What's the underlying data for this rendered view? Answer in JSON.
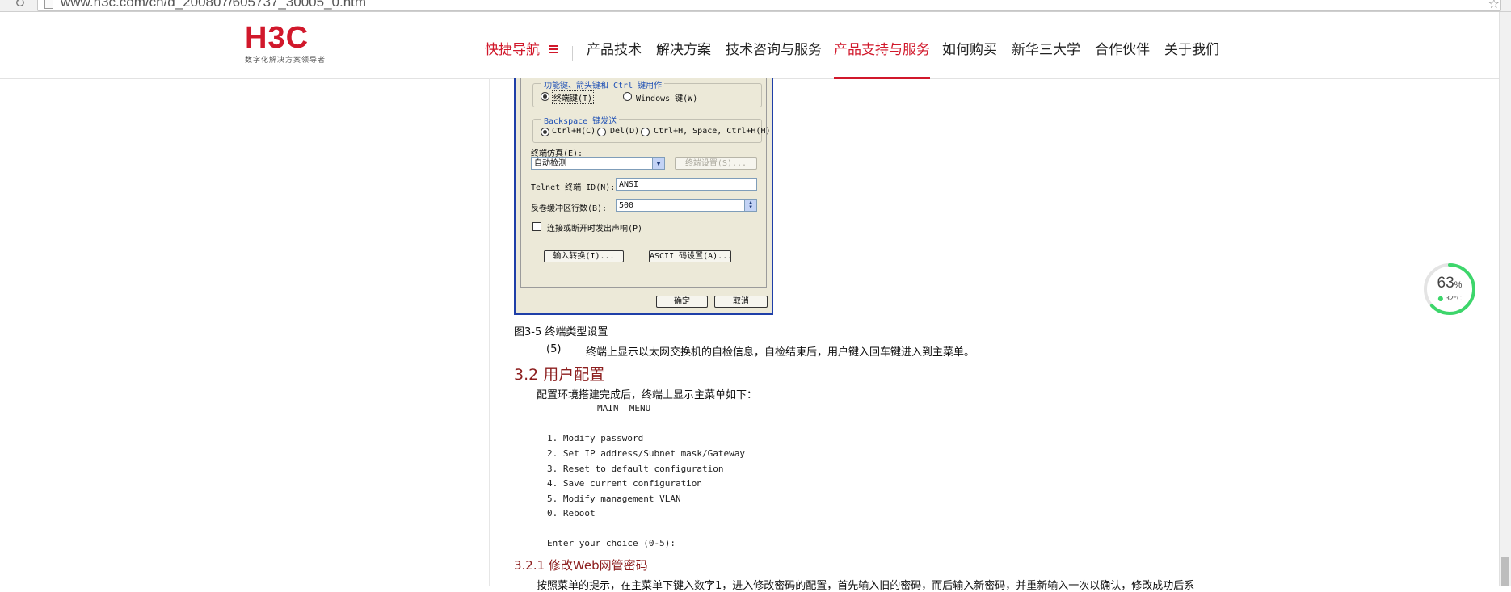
{
  "browser": {
    "url": "www.h3c.com/cn/d_200807/605737_30005_0.htm"
  },
  "site": {
    "logo": "H3C",
    "tagline": "数字化解决方案领导者",
    "nav": [
      {
        "label": "快捷导航"
      },
      {
        "label": "产品技术"
      },
      {
        "label": "解决方案"
      },
      {
        "label": "技术咨询与服务"
      },
      {
        "label": "产品支持与服务"
      },
      {
        "label": "如何购买"
      },
      {
        "label": "新华三大学"
      },
      {
        "label": "合作伙伴"
      },
      {
        "label": "关于我们"
      }
    ],
    "active_nav": "产品支持与服务",
    "accent_color": "#d1182b"
  },
  "dialog": {
    "group_keys": {
      "title": "功能键、箭头键和 Ctrl 键用作",
      "opt_terminal": "终端键(T)",
      "opt_windows": "Windows 键(W)",
      "selected": "终端键(T)"
    },
    "group_backspace": {
      "title": "Backspace 键发送",
      "opt1": "Ctrl+H(C)",
      "opt2": "Del(D)",
      "opt3": "Ctrl+H, Space, Ctrl+H(H)",
      "selected": "Ctrl+H(C)"
    },
    "emulation_label": "终端仿真(E):",
    "emulation_value": "自动检测",
    "terminal_settings_button": "终端设置(S)...",
    "telnet_id_label": "Telnet 终端 ID(N):",
    "telnet_id_value": "ANSI",
    "scrollback_label": "反卷缓冲区行数(B):",
    "scrollback_value": "500",
    "beep_label": "连接或断开时发出声响(P)",
    "input_translation_button": "输入转换(I)...",
    "ascii_setup_button": "ASCII 码设置(A)...",
    "ok_button": "确定",
    "cancel_button": "取消"
  },
  "doc": {
    "figure_caption": "图3-5 终端类型设置",
    "step5_num": "(5)",
    "step5_text": "终端上显示以太网交换机的自检信息，自检结束后，用户键入回车键进入到主菜单。",
    "section_heading": "3.2  用户配置",
    "intro": "配置环境搭建完成后，终端上显示主菜单如下：",
    "menu_title": "MAIN  MENU",
    "menu_items": [
      "1. Modify password",
      "2. Set IP address/Subnet mask/Gateway",
      "3. Reset to default configuration",
      "4. Save current configuration",
      "5. Modify management VLAN",
      "0. Reboot"
    ],
    "menu_prompt": "Enter your choice (0-5):",
    "subsection_heading": "3.2.1  修改Web网管密码",
    "cut_text": "按照菜单的提示，在主菜单下键入数字1，进入修改密码的配置，首先输入旧的密码，而后输入新密码，并重新输入一次以确认，修改成功后系"
  },
  "widget": {
    "percent": "63",
    "percent_unit": "%",
    "temp": "32°C",
    "level": 0.63
  }
}
